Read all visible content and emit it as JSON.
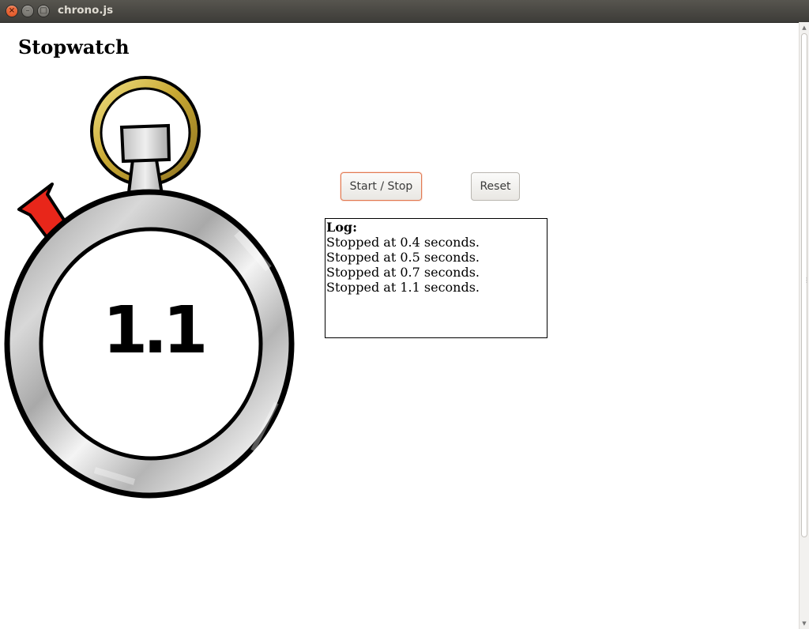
{
  "window": {
    "title": "chrono.js"
  },
  "page": {
    "heading": "Stopwatch"
  },
  "stopwatch": {
    "readout": "1.1"
  },
  "controls": {
    "start_stop_label": "Start / Stop",
    "reset_label": "Reset"
  },
  "log": {
    "heading": "Log:",
    "entries": [
      "Stopped at 0.4 seconds.",
      "Stopped at 0.5 seconds.",
      "Stopped at 0.7 seconds.",
      "Stopped at 1.1 seconds."
    ]
  },
  "colors": {
    "focus_border": "#e27a52",
    "pusher_red": "#e8261a",
    "ring_gold": "#d4b84a",
    "case_silver": "#c8c8c8"
  },
  "icons": [
    "close-icon",
    "minimize-icon",
    "maximize-icon"
  ]
}
